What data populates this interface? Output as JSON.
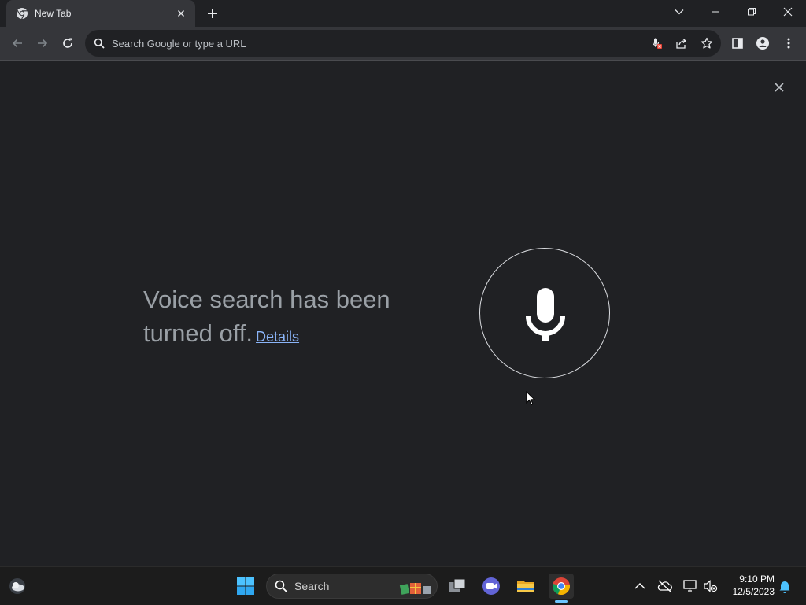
{
  "tab": {
    "title": "New Tab"
  },
  "omnibox": {
    "placeholder": "Search Google or type a URL"
  },
  "voice_search": {
    "message": "Voice search has been turned off.",
    "details_link": "Details"
  },
  "taskbar": {
    "search_label": "Search",
    "time": "9:10 PM",
    "date": "12/5/2023"
  },
  "colors": {
    "background": "#202124",
    "toolbar": "#35363a",
    "link": "#8ab4f8",
    "message_text": "#9aa0a6",
    "taskbar": "#1c1c1c"
  },
  "icons": {
    "favicon": "chrome-icon",
    "back": "arrow-left-icon",
    "forward": "arrow-right-icon",
    "reload": "reload-icon",
    "mic_blocked": "mic-blocked-icon",
    "share": "share-icon",
    "bookmark": "star-icon",
    "side_panel": "side-panel-icon",
    "profile": "profile-icon",
    "menu": "kebab-menu-icon",
    "voice": "microphone-icon"
  }
}
